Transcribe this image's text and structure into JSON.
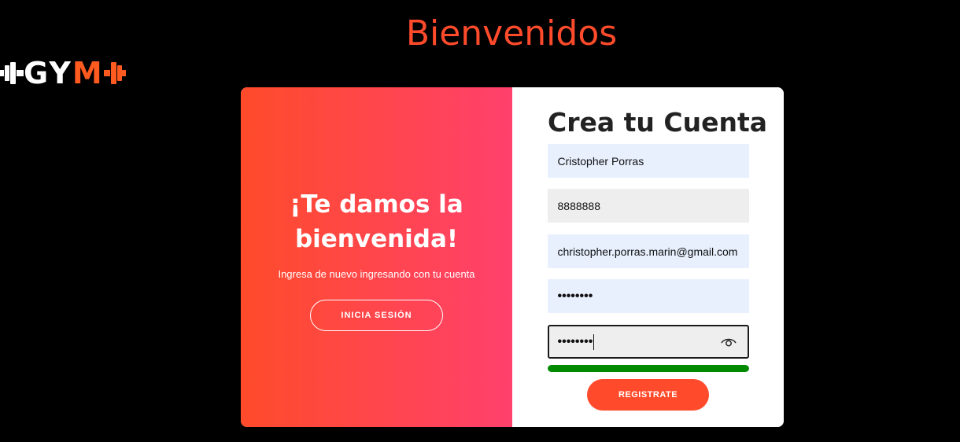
{
  "header": {
    "title": "Bienvenidos",
    "logo": {
      "left": "GY",
      "right": "M",
      "icon": "dumbbell-icon",
      "accent": "#ff5a1f"
    }
  },
  "overlay": {
    "title": "¡Te damos la bienvenida!",
    "subtitle": "Ingresa de nuevo ingresando con tu cuenta",
    "button_label": "INICIA SESIÓN",
    "gradient": [
      "#ff4b2b",
      "#ff416c"
    ]
  },
  "signup": {
    "title": "Crea tu Cuenta",
    "name_value": "Cristopher Porras",
    "phone_value": "8888888",
    "email_value": "christopher.porras.marin@gmail.com",
    "password_value": "••••••••",
    "confirm_password_value": "••••••••",
    "password_strength": 1.0,
    "strength_color": "#008a00",
    "eye_icon": "eye-icon",
    "button_label": "REGISTRATE",
    "button_color": "#ff4b2b"
  }
}
